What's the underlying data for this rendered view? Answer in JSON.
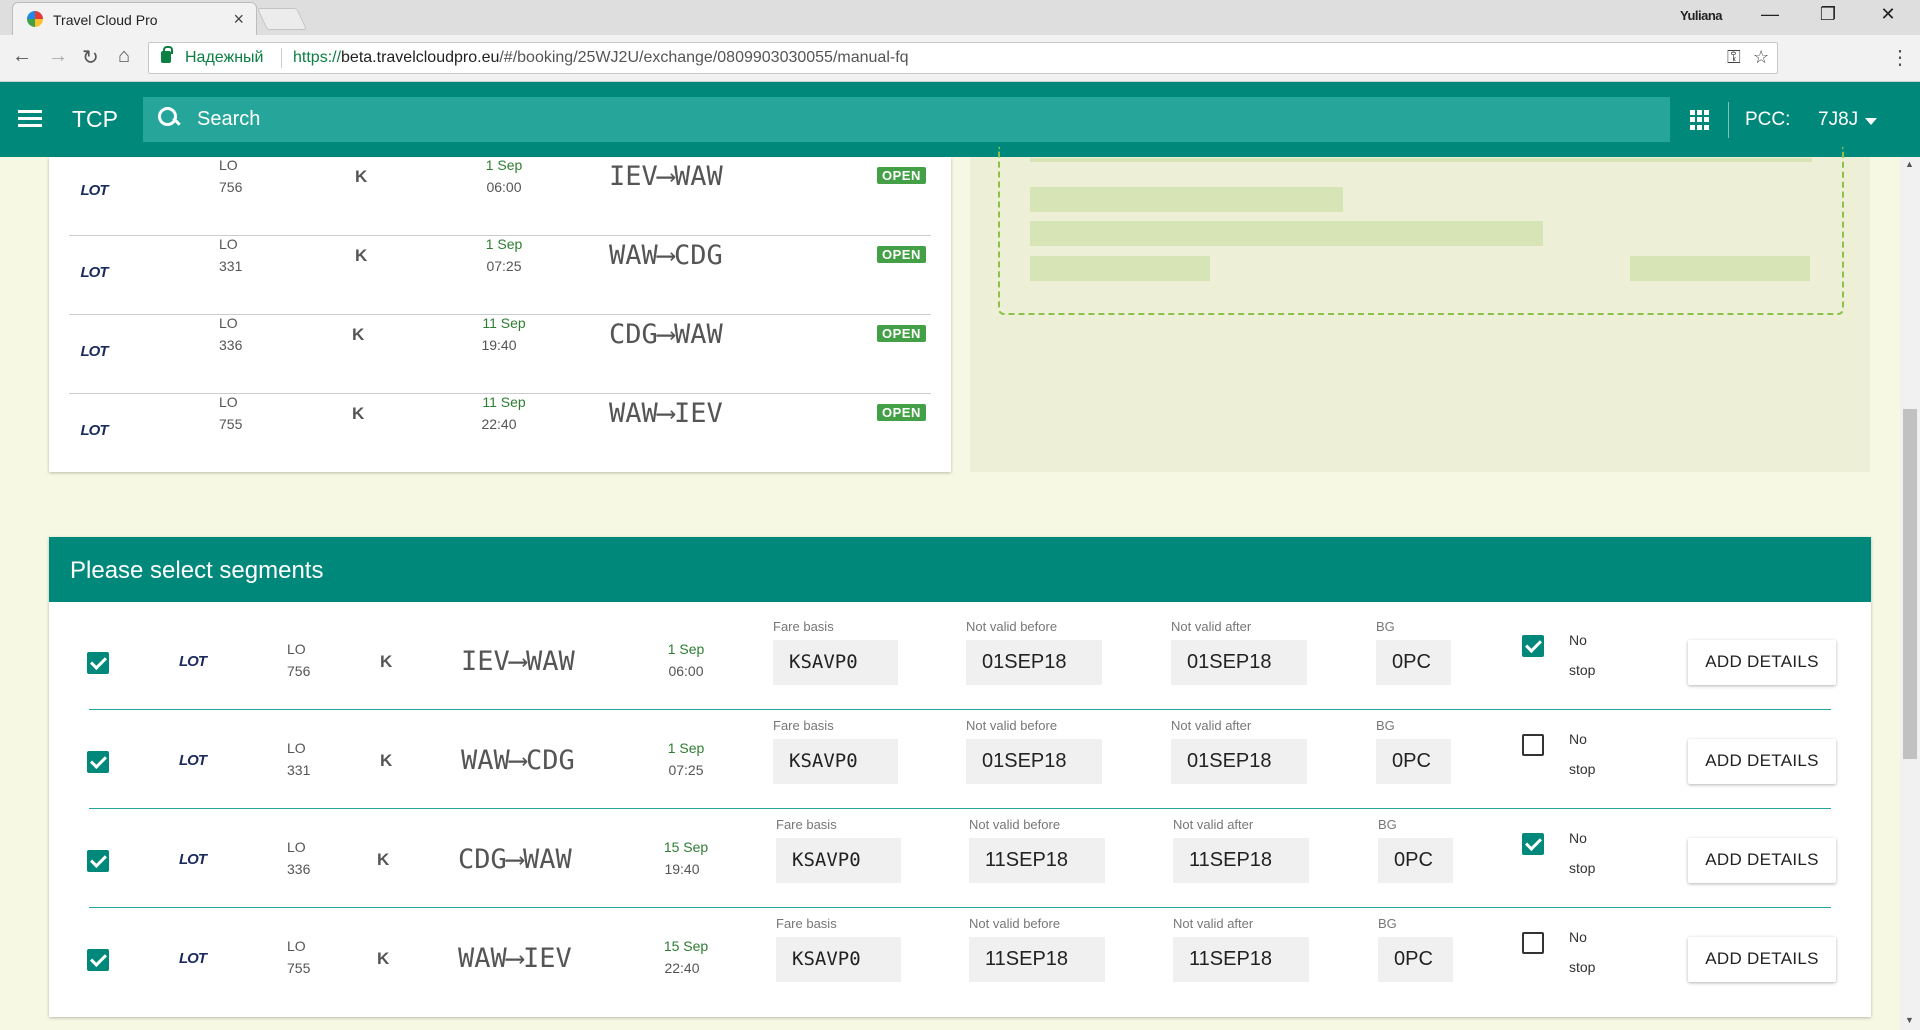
{
  "browser": {
    "tab_title": "Travel Cloud Pro",
    "tab_close": "×",
    "user": "Yuliana",
    "min": "—",
    "restore": "❐",
    "close": "✕",
    "secure_label": "Надежный",
    "url_scheme": "https://",
    "url_host": "beta.travelcloudpro.eu",
    "url_path": "/#/booking/25WJ2U/exchange/0809903030055/manual-fq",
    "back": "←",
    "forward": "→",
    "reload": "↻",
    "home": "⌂",
    "key": "⚿",
    "star": "☆",
    "menu": "⋮"
  },
  "header": {
    "brand": "TCP",
    "search_placeholder": "Search",
    "pcc_label": "PCC:",
    "pcc_value": "7J8J"
  },
  "flights": [
    {
      "airline": "LOT",
      "carrier": "LO",
      "number": "756",
      "class": "K",
      "date": "1 Sep",
      "time": "06:00",
      "route": "IEV⟶WAW",
      "status": "OPEN"
    },
    {
      "airline": "LOT",
      "carrier": "LO",
      "number": "331",
      "class": "K",
      "date": "1 Sep",
      "time": "07:25",
      "route": "WAW⟶CDG",
      "status": "OPEN"
    },
    {
      "airline": "LOT",
      "carrier": "LO",
      "number": "336",
      "class": "K",
      "date": "11 Sep",
      "time": "19:40",
      "route": "CDG⟶WAW",
      "status": "OPEN"
    },
    {
      "airline": "LOT",
      "carrier": "LO",
      "number": "755",
      "class": "K",
      "date": "11 Sep",
      "time": "22:40",
      "route": "WAW⟶IEV",
      "status": "OPEN"
    }
  ],
  "segments_panel": {
    "title": "Please select segments",
    "labels": {
      "fare_basis": "Fare basis",
      "not_valid_before": "Not valid before",
      "not_valid_after": "Not valid after",
      "bg": "BG",
      "no": "No",
      "stop": "stop",
      "add_details": "ADD DETAILS"
    },
    "rows": [
      {
        "selected": true,
        "airline": "LOT",
        "carrier": "LO",
        "number": "756",
        "class": "K",
        "route": "IEV⟶WAW",
        "date": "1 Sep",
        "time": "06:00",
        "fare_basis": "KSAVP0",
        "nvb": "01SEP18",
        "nva": "01SEP18",
        "bg": "0PC",
        "no_stop": true
      },
      {
        "selected": true,
        "airline": "LOT",
        "carrier": "LO",
        "number": "331",
        "class": "K",
        "route": "WAW⟶CDG",
        "date": "1 Sep",
        "time": "07:25",
        "fare_basis": "KSAVP0",
        "nvb": "01SEP18",
        "nva": "01SEP18",
        "bg": "0PC",
        "no_stop": false
      },
      {
        "selected": true,
        "airline": "LOT",
        "carrier": "LO",
        "number": "336",
        "class": "K",
        "route": "CDG⟶WAW",
        "date": "15 Sep",
        "time": "19:40",
        "fare_basis": "KSAVP0",
        "nvb": "11SEP18",
        "nva": "11SEP18",
        "bg": "0PC",
        "no_stop": true
      },
      {
        "selected": true,
        "airline": "LOT",
        "carrier": "LO",
        "number": "755",
        "class": "K",
        "route": "WAW⟶IEV",
        "date": "15 Sep",
        "time": "22:40",
        "fare_basis": "KSAVP0",
        "nvb": "11SEP18",
        "nva": "11SEP18",
        "bg": "0PC",
        "no_stop": false
      }
    ]
  },
  "colors": {
    "primary": "#00897b",
    "open_badge": "#43a047",
    "page_bg": "#f7f8e4"
  }
}
